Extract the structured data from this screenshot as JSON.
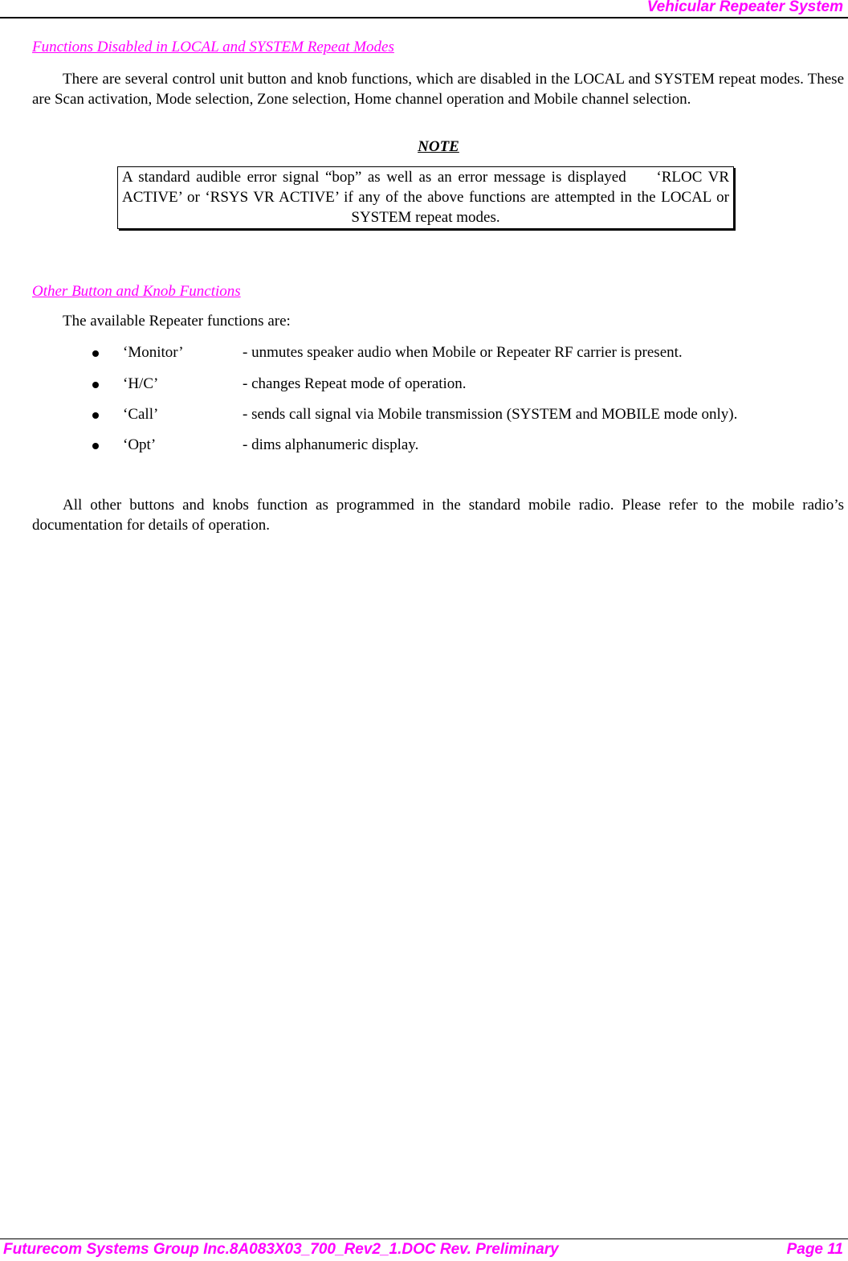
{
  "header": {
    "title": "Vehicular Repeater System"
  },
  "section1": {
    "heading": "Functions Disabled in LOCAL and SYSTEM Repeat Modes",
    "paragraph": "There are several control unit button and knob functions, which are disabled in the LOCAL and SYSTEM repeat modes.  These are Scan activation, Mode selection, Zone selection, Home channel operation and Mobile channel selection."
  },
  "note": {
    "label": "NOTE",
    "text": "A standard audible error signal “bop” as well as an error message is displayed     ‘RLOC VR ACTIVE’ or ‘RSYS VR ACTIVE’ if any of the above functions are attempted in the LOCAL or SYSTEM repeat modes."
  },
  "section2": {
    "heading": "Other Button and Knob Functions",
    "intro": "The available Repeater functions are:",
    "bullets": [
      {
        "key": "‘Monitor’",
        "desc": "- unmutes speaker audio when Mobile or Repeater RF carrier is present."
      },
      {
        "key": "‘H/C’",
        "desc": "- changes Repeat mode of operation."
      },
      {
        "key": "‘Call’",
        "desc": "- sends call signal via Mobile transmission (SYSTEM and MOBILE mode only)."
      },
      {
        "key": "‘Opt’",
        "desc": "- dims alphanumeric display."
      }
    ],
    "closing": "All other buttons and knobs function as programmed in the standard mobile radio. Please refer to the mobile radio’s documentation for details of operation."
  },
  "footer": {
    "left": "Futurecom Systems Group Inc.8A083X03_700_Rev2_1.DOC Rev. Preliminary",
    "right": "Page 11"
  },
  "colors": {
    "accent": "#ff00ff",
    "text": "#000000"
  }
}
